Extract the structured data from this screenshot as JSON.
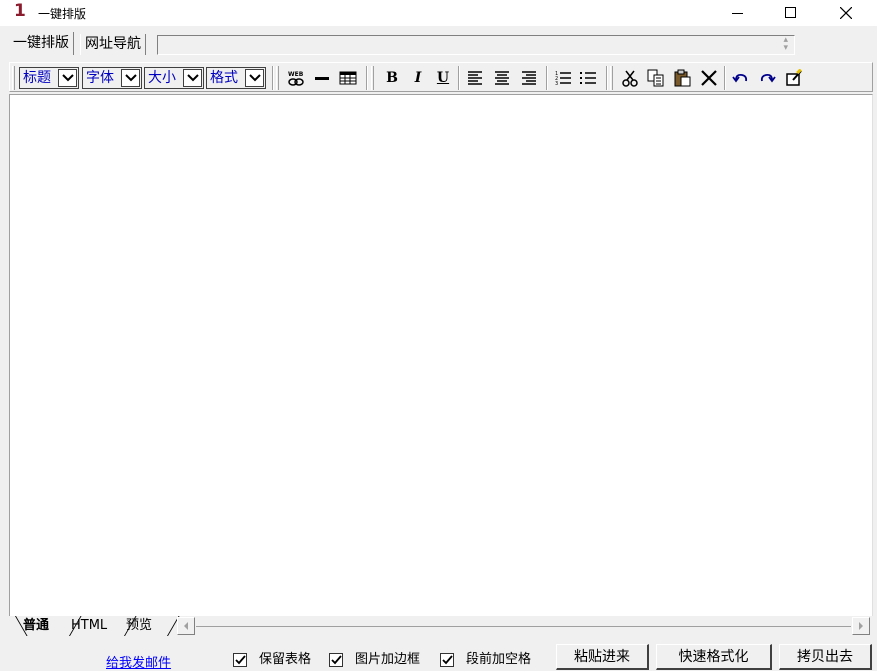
{
  "window": {
    "app_icon_text": "1",
    "title": "一键排版"
  },
  "top_tabs": [
    {
      "label": "一键排版",
      "active": true
    },
    {
      "label": "网址导航",
      "active": false
    }
  ],
  "address": {
    "value": ""
  },
  "toolbar": {
    "dropdowns": [
      {
        "label": "标题"
      },
      {
        "label": "字体"
      },
      {
        "label": "大小"
      },
      {
        "label": "格式"
      }
    ],
    "insert_icons": [
      "web-link-icon",
      "horizontal-rule-icon",
      "table-icon"
    ],
    "format_icons": [
      {
        "name": "bold-icon",
        "glyph": "B"
      },
      {
        "name": "italic-icon",
        "glyph": "I"
      },
      {
        "name": "underline-icon",
        "glyph": "U"
      }
    ],
    "align_icons": [
      "align-left-icon",
      "align-center-icon",
      "align-right-icon"
    ],
    "list_icons": [
      "numbered-list-icon",
      "bullet-list-icon"
    ],
    "edit_icons": [
      "cut-icon",
      "copy-icon",
      "paste-icon",
      "delete-icon"
    ],
    "history_icons": [
      "undo-icon",
      "redo-icon",
      "edit-note-icon"
    ]
  },
  "editor": {
    "content": ""
  },
  "bottom_tabs": [
    {
      "label": "普通",
      "active": true
    },
    {
      "label": "HTML",
      "active": false
    },
    {
      "label": "预览",
      "active": false
    }
  ],
  "footer": {
    "mail_link": "给我发邮件",
    "checkboxes": [
      {
        "label": "保留表格",
        "checked": true
      },
      {
        "label": "图片加边框",
        "checked": true
      },
      {
        "label": "段前加空格",
        "checked": true
      }
    ],
    "buttons": [
      {
        "label": "粘贴进来"
      },
      {
        "label": "快速格式化"
      },
      {
        "label": "拷贝出去"
      }
    ]
  },
  "colors": {
    "app_icon": "#8b1c2e",
    "dropdown_text": "#0000c0",
    "link": "#0000ff"
  }
}
